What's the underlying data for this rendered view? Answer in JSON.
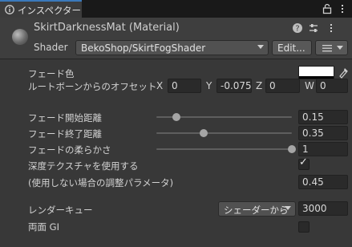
{
  "tab": {
    "title": "インスペクター"
  },
  "header": {
    "title": "SkirtDarknessMat (Material)",
    "shader_label": "Shader",
    "shader_value": "BekoShop/SkirtFogShader",
    "edit_button": "Edit...",
    "list_icon": "list-icon"
  },
  "properties": {
    "fade_color": {
      "label": "フェード色",
      "color": "#ffffff"
    },
    "root_bone_offset": {
      "label": "ルートボーンからのオフセット",
      "x_label": "X",
      "x": "0",
      "y_label": "Y",
      "y": "-0.075",
      "z_label": "Z",
      "z": "0",
      "w_label": "W",
      "w": "0"
    },
    "fade_start": {
      "label": "フェード開始距離",
      "value": "0.15",
      "fraction": 0.15
    },
    "fade_end": {
      "label": "フェード終了距離",
      "value": "0.35",
      "fraction": 0.35
    },
    "fade_softness": {
      "label": "フェードの柔らかさ",
      "value": "1",
      "fraction": 1.0
    },
    "use_depth": {
      "label": "深度テクスチャを使用する",
      "checked": true
    },
    "adjust_param": {
      "label": "(使用しない場合の調整パラメータ)",
      "value": "0.45"
    },
    "render_queue": {
      "label": "レンダーキュー",
      "dropdown": "シェーダーから",
      "value": "3000"
    },
    "double_sided_gi": {
      "label": "両面 GI",
      "checked": false
    }
  }
}
